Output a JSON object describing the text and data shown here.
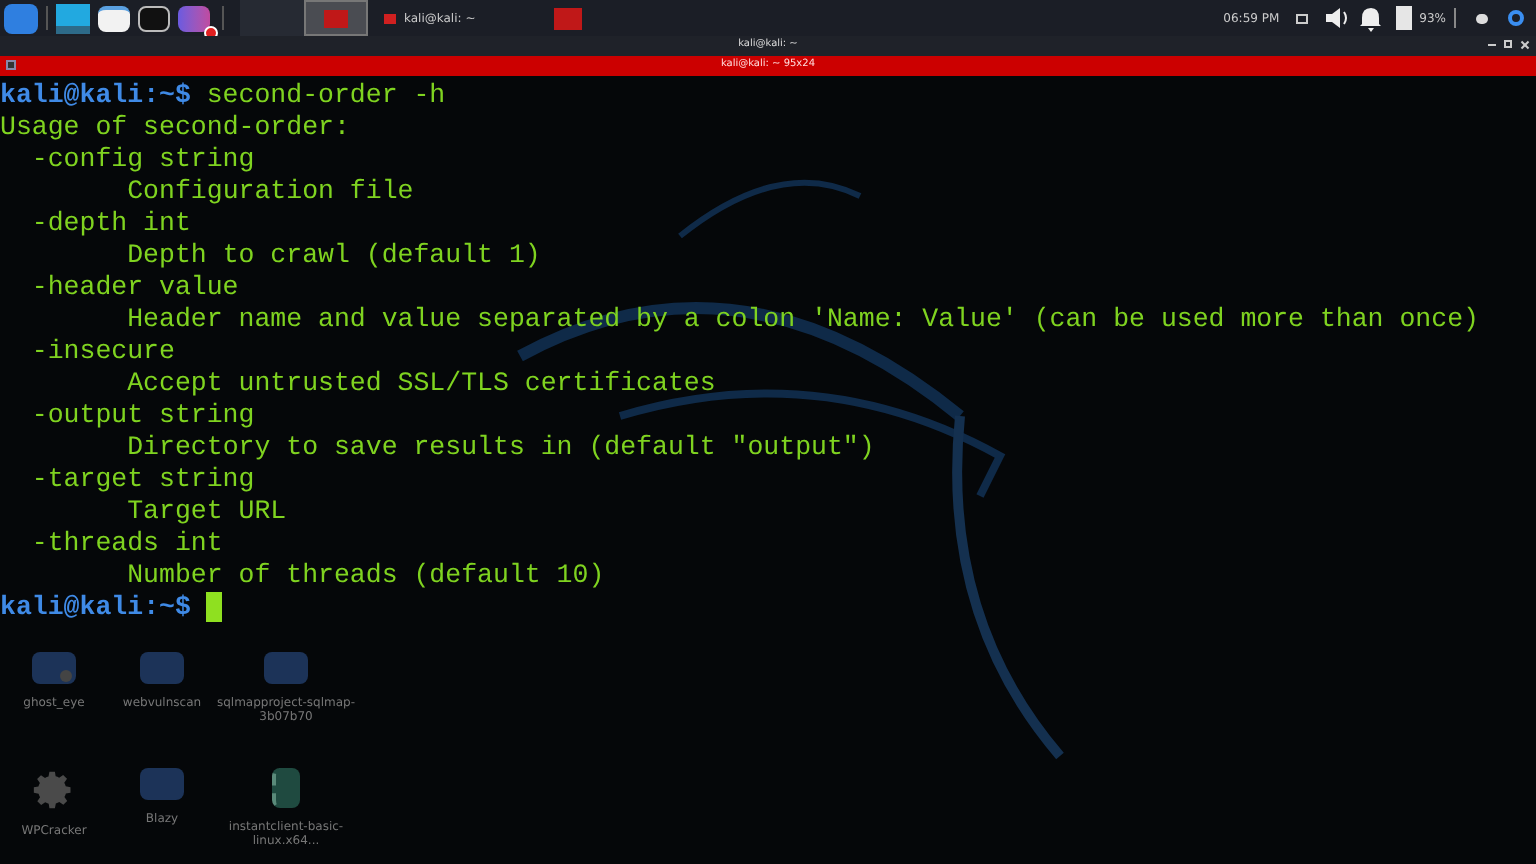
{
  "taskbar": {
    "launchers": [
      {
        "kind": "kali"
      },
      {
        "kind": "desktop"
      },
      {
        "kind": "files"
      },
      {
        "kind": "terminal"
      },
      {
        "kind": "recorder"
      }
    ],
    "workspaces": [
      {
        "selected": false
      },
      {
        "selected": true
      }
    ],
    "tasks": [
      {
        "label": "kali@kali: ~"
      }
    ],
    "clock": "06:59 PM",
    "battery": "93%"
  },
  "window": {
    "title": "kali@kali: ~",
    "tab_title": "kali@kali: ~ 95x24"
  },
  "terminal": {
    "lines": [
      {
        "kind": "command",
        "user": "kali@kali",
        "path": ":~$",
        "text": "second-order -h"
      },
      {
        "kind": "usage",
        "text": "Usage of second-order:"
      },
      {
        "kind": "flag",
        "text": "-config string"
      },
      {
        "kind": "desc",
        "text": "Configuration file"
      },
      {
        "kind": "flag",
        "text": "-depth int"
      },
      {
        "kind": "desc",
        "text": "Depth to crawl (default 1)"
      },
      {
        "kind": "flag",
        "text": "-header value"
      },
      {
        "kind": "desc",
        "text": "Header name and value separated by a colon 'Name: Value' (can be used more than once)"
      },
      {
        "kind": "flag",
        "text": "-insecure"
      },
      {
        "kind": "desc",
        "text": "Accept untrusted SSL/TLS certificates"
      },
      {
        "kind": "flag",
        "text": "-output string"
      },
      {
        "kind": "desc",
        "text": "Directory to save results in (default \"output\")"
      },
      {
        "kind": "flag",
        "text": "-target string"
      },
      {
        "kind": "desc",
        "text": "Target URL"
      },
      {
        "kind": "flag",
        "text": "-threads int"
      },
      {
        "kind": "desc",
        "text": "Number of threads (default 10)"
      },
      {
        "kind": "prompt",
        "user": "kali@kali",
        "path": ":~$"
      }
    ]
  },
  "desktop_icons": [
    {
      "kind": "locked-folder",
      "label": "ghost_eye"
    },
    {
      "kind": "folder",
      "label": "webvulnscan"
    },
    {
      "kind": "folder",
      "label": "sqlmapproject-sqlmap-3b07b70"
    },
    {
      "kind": "gear",
      "label": "WPCracker"
    },
    {
      "kind": "folder",
      "label": "Blazy"
    },
    {
      "kind": "archive",
      "label": "instantclient-basic-linux.x64..."
    }
  ]
}
